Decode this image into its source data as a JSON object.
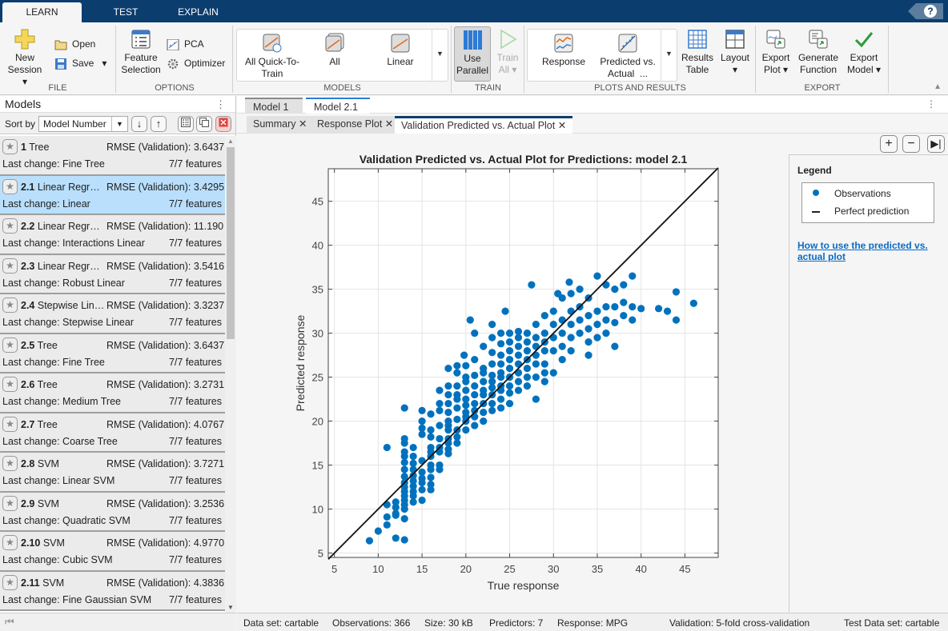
{
  "top_tabs": [
    "LEARN",
    "TEST",
    "EXPLAIN"
  ],
  "help_label": "?",
  "ribbon": {
    "file": {
      "label": "FILE",
      "new_session": "New",
      "new_session2": "Session",
      "open": "Open",
      "save": "Save"
    },
    "options": {
      "label": "OPTIONS",
      "feature_selection": "Feature",
      "feature_selection2": "Selection",
      "pca": "PCA",
      "optimizer": "Optimizer"
    },
    "models": {
      "label": "MODELS",
      "items": [
        "All Quick-To-",
        "Train",
        "All",
        "Linear"
      ]
    },
    "train": {
      "label": "TRAIN",
      "use_parallel": "Use",
      "use_parallel2": "Parallel",
      "train_all": "Train",
      "train_all2": "All"
    },
    "plots": {
      "label": "PLOTS AND RESULTS",
      "response": "Response",
      "pred_actual": "Predicted vs.",
      "pred_actual2": "Actual",
      "pred_actual_more": "...",
      "results_table": "Results",
      "results_table2": "Table",
      "layout": "Layout"
    },
    "export": {
      "label": "EXPORT",
      "export_plot": "Export",
      "export_plot2": "Plot",
      "gen_func": "Generate",
      "gen_func2": "Function",
      "export_model": "Export",
      "export_model2": "Model"
    }
  },
  "models_panel": {
    "title": "Models",
    "sort_label": "Sort by",
    "sort_value": "Model Number",
    "models": [
      {
        "num": "1",
        "type": "Tree",
        "rmse": "RMSE (Validation): 3.6437",
        "last": "Last change: Fine Tree",
        "features": "7/7 features"
      },
      {
        "num": "2.1",
        "type": "Linear Regr…",
        "rmse": "RMSE (Validation): 3.4295",
        "last": "Last change: Linear",
        "features": "7/7 features",
        "selected": true
      },
      {
        "num": "2.2",
        "type": "Linear Regr…",
        "rmse": "RMSE (Validation): 11.190",
        "last": "Last change: Interactions Linear",
        "features": "7/7 features"
      },
      {
        "num": "2.3",
        "type": "Linear Regr…",
        "rmse": "RMSE (Validation): 3.5416",
        "last": "Last change: Robust Linear",
        "features": "7/7 features"
      },
      {
        "num": "2.4",
        "type": "Stepwise Lin…",
        "rmse": "RMSE (Validation): 3.3237",
        "last": "Last change: Stepwise Linear",
        "features": "7/7 features"
      },
      {
        "num": "2.5",
        "type": "Tree",
        "rmse": "RMSE (Validation): 3.6437",
        "last": "Last change: Fine Tree",
        "features": "7/7 features"
      },
      {
        "num": "2.6",
        "type": "Tree",
        "rmse": "RMSE (Validation): 3.2731",
        "last": "Last change: Medium Tree",
        "features": "7/7 features"
      },
      {
        "num": "2.7",
        "type": "Tree",
        "rmse": "RMSE (Validation): 4.0767",
        "last": "Last change: Coarse Tree",
        "features": "7/7 features"
      },
      {
        "num": "2.8",
        "type": "SVM",
        "rmse": "RMSE (Validation): 3.7271",
        "last": "Last change: Linear SVM",
        "features": "7/7 features"
      },
      {
        "num": "2.9",
        "type": "SVM",
        "rmse": "RMSE (Validation): 3.2536",
        "last": "Last change: Quadratic SVM",
        "features": "7/7 features"
      },
      {
        "num": "2.10",
        "type": "SVM",
        "rmse": "RMSE (Validation): 4.9770",
        "last": "Last change: Cubic SVM",
        "features": "7/7 features"
      },
      {
        "num": "2.11",
        "type": "SVM",
        "rmse": "RMSE (Validation): 4.3836",
        "last": "Last change: Fine Gaussian SVM",
        "features": "7/7 features"
      }
    ]
  },
  "doc_tabs": [
    "Model 1",
    "Model 2.1"
  ],
  "sub_tabs": [
    "Summary",
    "Response Plot",
    "Validation Predicted vs. Actual Plot"
  ],
  "legend": {
    "title": "Legend",
    "items": [
      "Observations",
      "Perfect prediction"
    ],
    "help_link": "How to use the predicted vs.",
    "help_link2": "actual plot"
  },
  "status": {
    "dataset": "Data set: cartable",
    "observations": "Observations: 366",
    "size": "Size: 30 kB",
    "predictors": "Predictors: 7",
    "response": "Response: MPG",
    "validation": "Validation: 5-fold cross-validation",
    "test_dataset": "Test Data set: cartable"
  },
  "colors": {
    "accent": "#0b3d6e",
    "point": "#0072bd",
    "selected": "#b9dffc"
  },
  "chart_data": {
    "type": "scatter",
    "title": "Validation Predicted vs. Actual Plot for Predictions: model 2.1",
    "xlabel": "True response",
    "ylabel": "Predicted response",
    "xlim": [
      4.3,
      48.8
    ],
    "ylim": [
      4.5,
      48.7
    ],
    "xticks": [
      5,
      10,
      15,
      20,
      25,
      30,
      35,
      40,
      45
    ],
    "yticks": [
      5,
      10,
      15,
      20,
      25,
      30,
      35,
      40,
      45
    ],
    "grid": true,
    "legend_position": "side-panel",
    "series": [
      {
        "name": "Observations",
        "kind": "points",
        "points": [
          [
            9,
            6.4
          ],
          [
            10,
            7.5
          ],
          [
            11,
            8.2
          ],
          [
            12,
            6.7
          ],
          [
            13,
            6.5
          ],
          [
            11,
            9.1
          ],
          [
            12,
            9.5
          ],
          [
            12,
            9.3
          ],
          [
            13,
            8.9
          ],
          [
            11,
            10.5
          ],
          [
            12,
            10.8
          ],
          [
            12,
            10.2
          ],
          [
            13,
            10.0
          ],
          [
            13,
            10.5
          ],
          [
            13,
            11.0
          ],
          [
            13,
            11.5
          ],
          [
            13,
            12.0
          ],
          [
            13,
            12.5
          ],
          [
            13,
            13.0
          ],
          [
            13,
            13.7
          ],
          [
            13,
            14.5
          ],
          [
            13,
            15.3
          ],
          [
            13,
            16.0
          ],
          [
            13,
            16.5
          ],
          [
            13,
            17.5
          ],
          [
            13,
            18.0
          ],
          [
            13,
            21.5
          ],
          [
            11,
            17.0
          ],
          [
            14,
            10.8
          ],
          [
            14,
            11.5
          ],
          [
            14,
            12.0
          ],
          [
            14,
            12.6
          ],
          [
            14,
            13.2
          ],
          [
            14,
            13.8
          ],
          [
            14,
            14.5
          ],
          [
            14,
            15.2
          ],
          [
            14,
            16.0
          ],
          [
            14,
            17.0
          ],
          [
            15,
            11.0
          ],
          [
            15,
            12.2
          ],
          [
            15,
            13.0
          ],
          [
            15,
            13.5
          ],
          [
            15,
            14.2
          ],
          [
            15,
            15.5
          ],
          [
            15,
            18.5
          ],
          [
            15,
            19.2
          ],
          [
            15,
            20.0
          ],
          [
            15,
            21.2
          ],
          [
            16,
            12.2
          ],
          [
            16,
            12.8
          ],
          [
            16,
            13.6
          ],
          [
            16,
            14.5
          ],
          [
            16,
            15.0
          ],
          [
            16,
            16.0
          ],
          [
            16,
            16.5
          ],
          [
            16,
            17.0
          ],
          [
            16,
            18.2
          ],
          [
            16,
            19.0
          ],
          [
            16,
            20.8
          ],
          [
            17,
            14.5
          ],
          [
            17,
            15.0
          ],
          [
            17,
            16.5
          ],
          [
            17,
            17.0
          ],
          [
            17,
            18.0
          ],
          [
            17,
            19.5
          ],
          [
            17,
            21.2
          ],
          [
            17,
            22.0
          ],
          [
            17,
            23.5
          ],
          [
            18,
            16.3
          ],
          [
            18,
            16.8
          ],
          [
            18,
            17.5
          ],
          [
            18,
            18.0
          ],
          [
            18,
            19.0
          ],
          [
            18,
            19.5
          ],
          [
            18,
            20.0
          ],
          [
            18,
            21.0
          ],
          [
            18,
            22.0
          ],
          [
            18,
            23.0
          ],
          [
            18,
            24.0
          ],
          [
            18,
            26.0
          ],
          [
            19,
            17.5
          ],
          [
            19,
            18.2
          ],
          [
            19,
            19.0
          ],
          [
            19,
            20.2
          ],
          [
            19,
            21.5
          ],
          [
            19,
            22.5
          ],
          [
            19,
            23.0
          ],
          [
            19,
            24.0
          ],
          [
            19,
            25.5
          ],
          [
            19,
            26.3
          ],
          [
            20,
            19.0
          ],
          [
            20,
            20.0
          ],
          [
            20,
            20.5
          ],
          [
            20,
            21.0
          ],
          [
            20,
            21.8
          ],
          [
            20,
            22.5
          ],
          [
            20,
            23.5
          ],
          [
            20,
            24.5
          ],
          [
            20,
            25.0
          ],
          [
            20,
            26.3
          ],
          [
            21,
            19.5
          ],
          [
            21,
            20.5
          ],
          [
            21,
            21.2
          ],
          [
            21,
            22.0
          ],
          [
            21,
            23.0
          ],
          [
            21,
            24.0
          ],
          [
            21,
            25.2
          ],
          [
            21,
            27.0
          ],
          [
            21,
            30.0
          ],
          [
            22,
            20.0
          ],
          [
            22,
            21.0
          ],
          [
            22,
            22.0
          ],
          [
            22,
            23.0
          ],
          [
            22,
            23.5
          ],
          [
            22,
            24.5
          ],
          [
            22,
            25.5
          ],
          [
            22,
            26.0
          ],
          [
            22,
            28.5
          ],
          [
            23,
            21.2
          ],
          [
            23,
            22.0
          ],
          [
            23,
            23.0
          ],
          [
            23,
            23.8
          ],
          [
            23,
            24.5
          ],
          [
            23,
            25.2
          ],
          [
            23,
            26.5
          ],
          [
            23,
            27.8
          ],
          [
            23,
            29.5
          ],
          [
            23,
            31.0
          ],
          [
            24,
            21.5
          ],
          [
            24,
            22.5
          ],
          [
            24,
            23.5
          ],
          [
            24,
            24.0
          ],
          [
            24,
            25.0
          ],
          [
            24,
            25.5
          ],
          [
            24,
            26.5
          ],
          [
            24,
            27.5
          ],
          [
            24,
            28.8
          ],
          [
            24,
            30.0
          ],
          [
            25,
            22.0
          ],
          [
            25,
            23.2
          ],
          [
            25,
            24.0
          ],
          [
            25,
            25.0
          ],
          [
            25,
            26.0
          ],
          [
            25,
            27.0
          ],
          [
            25,
            28.0
          ],
          [
            25,
            29.0
          ],
          [
            25,
            30.0
          ],
          [
            26,
            23.5
          ],
          [
            26,
            24.5
          ],
          [
            26,
            25.5
          ],
          [
            26,
            26.5
          ],
          [
            26,
            27.5
          ],
          [
            26,
            28.5
          ],
          [
            26,
            29.5
          ],
          [
            26,
            30.2
          ],
          [
            27,
            24.0
          ],
          [
            27,
            25.0
          ],
          [
            27,
            26.0
          ],
          [
            27,
            27.0
          ],
          [
            27,
            28.0
          ],
          [
            27,
            29.0
          ],
          [
            27,
            30.0
          ],
          [
            28,
            22.5
          ],
          [
            28,
            25.0
          ],
          [
            28,
            26.5
          ],
          [
            28,
            27.5
          ],
          [
            28,
            28.5
          ],
          [
            28,
            29.5
          ],
          [
            28,
            31.0
          ],
          [
            29,
            24.5
          ],
          [
            29,
            25.5
          ],
          [
            29,
            26.5
          ],
          [
            29,
            28.0
          ],
          [
            29,
            29.0
          ],
          [
            29,
            30.0
          ],
          [
            29,
            32.0
          ],
          [
            30,
            25.5
          ],
          [
            30,
            28.0
          ],
          [
            30,
            29.5
          ],
          [
            30,
            31.0
          ],
          [
            30,
            32.5
          ],
          [
            31,
            27.0
          ],
          [
            31,
            28.5
          ],
          [
            31,
            30.0
          ],
          [
            31,
            31.5
          ],
          [
            31,
            34.0
          ],
          [
            32,
            28.0
          ],
          [
            32,
            29.5
          ],
          [
            32,
            31.0
          ],
          [
            32,
            32.5
          ],
          [
            32,
            34.5
          ],
          [
            33,
            30.0
          ],
          [
            33,
            31.5
          ],
          [
            33,
            33.0
          ],
          [
            33,
            35.0
          ],
          [
            34,
            27.5
          ],
          [
            34,
            29.0
          ],
          [
            34,
            30.5
          ],
          [
            34,
            32.0
          ],
          [
            34,
            34.0
          ],
          [
            35,
            29.5
          ],
          [
            35,
            31.0
          ],
          [
            35,
            32.5
          ],
          [
            35,
            36.5
          ],
          [
            36,
            30.0
          ],
          [
            36,
            31.5
          ],
          [
            36,
            33.0
          ],
          [
            36,
            35.5
          ],
          [
            37,
            28.5
          ],
          [
            37,
            31.2
          ],
          [
            37,
            33.0
          ],
          [
            37,
            35.0
          ],
          [
            38,
            32.0
          ],
          [
            38,
            33.5
          ],
          [
            38,
            35.5
          ],
          [
            39,
            31.5
          ],
          [
            39,
            33.0
          ],
          [
            39,
            36.5
          ],
          [
            40,
            32.8
          ],
          [
            42,
            32.8
          ],
          [
            43,
            32.5
          ],
          [
            44,
            31.5
          ],
          [
            44,
            34.7
          ],
          [
            46,
            33.4
          ],
          [
            30.5,
            34.5
          ],
          [
            31.8,
            35.8
          ],
          [
            27.5,
            35.5
          ],
          [
            24.5,
            32.5
          ],
          [
            19.8,
            27.5
          ],
          [
            20.5,
            31.5
          ]
        ]
      },
      {
        "name": "Perfect prediction",
        "kind": "line",
        "points": [
          [
            4.3,
            4.3
          ],
          [
            48.8,
            48.8
          ]
        ]
      }
    ]
  }
}
